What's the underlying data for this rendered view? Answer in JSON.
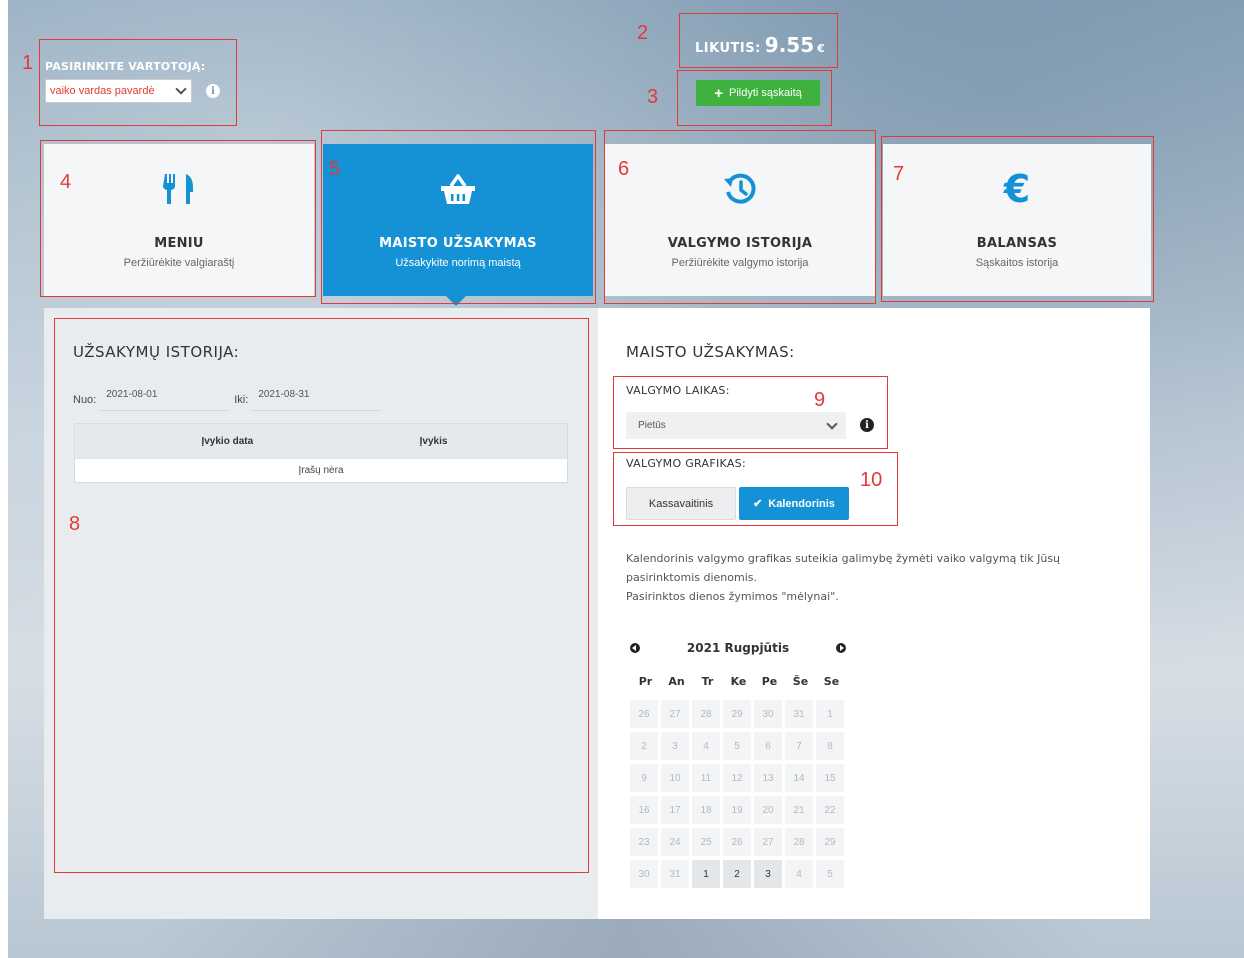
{
  "user_selector": {
    "label": "PASIRINKITE VARTOTOJĄ:",
    "selected": "vaiko vardas pavardė",
    "info_icon": "info-icon"
  },
  "balance": {
    "label": "LIKUTIS:",
    "amount": "9.55",
    "currency": "€"
  },
  "topup": {
    "label": "Pildyti sąskaitą",
    "icon": "plus-icon",
    "color": "#3fb13f"
  },
  "cards": [
    {
      "title": "MENIU",
      "subtitle": "Peržiūrėkite valgiaraštį",
      "icon": "fork-knife-icon",
      "active": false
    },
    {
      "title": "MAISTO UŽSAKYMAS",
      "subtitle": "Užsakykite norimą maistą",
      "icon": "basket-icon",
      "active": true
    },
    {
      "title": "VALGYMO ISTORIJA",
      "subtitle": "Peržiūrėkite valgymo istorija",
      "icon": "history-icon",
      "active": false
    },
    {
      "title": "BALANSAS",
      "subtitle": "Sąskaitos istorija",
      "icon": "euro-icon",
      "active": false
    }
  ],
  "order_history": {
    "title": "UŽSAKYMŲ ISTORIJA:",
    "from_label": "Nuo:",
    "from_value": "2021-08-01",
    "to_label": "Iki:",
    "to_value": "2021-08-31",
    "columns": [
      "Įvykio data",
      "Įvykis"
    ],
    "empty_text": "Įrašų nėra"
  },
  "food_order": {
    "title": "MAISTO UŽSAKYMAS:",
    "meal_time_label": "VALGYMO LAIKAS:",
    "meal_time_value": "Pietūs",
    "schedule_label": "VALGYMO GRAFIKAS:",
    "schedule_options": [
      "Kassavaitinis",
      "Kalendorinis"
    ],
    "schedule_selected": "Kalendorinis",
    "description_1": "Kalendorinis valgymo grafikas suteikia galimybę žymėti vaiko valgymą tik Jūsų pasirinktomis dienomis.",
    "description_2": "Pasirinktos dienos žymimos \"mėlynai\"."
  },
  "calendar": {
    "title": "2021 Rugpjūtis",
    "weekdays": [
      "Pr",
      "An",
      "Tr",
      "Ke",
      "Pe",
      "Še",
      "Se"
    ],
    "rows": [
      [
        "26",
        "27",
        "28",
        "29",
        "30",
        "31",
        "1"
      ],
      [
        "2",
        "3",
        "4",
        "5",
        "6",
        "7",
        "8"
      ],
      [
        "9",
        "10",
        "11",
        "12",
        "13",
        "14",
        "15"
      ],
      [
        "16",
        "17",
        "18",
        "19",
        "20",
        "21",
        "22"
      ],
      [
        "23",
        "24",
        "25",
        "26",
        "27",
        "28",
        "29"
      ],
      [
        "30",
        "31",
        "1",
        "2",
        "3",
        "4",
        "5"
      ]
    ],
    "highlighted": [
      [
        5,
        2
      ],
      [
        5,
        3
      ],
      [
        5,
        4
      ]
    ]
  },
  "annotations": [
    "1",
    "2",
    "3",
    "4",
    "5",
    "6",
    "7",
    "8",
    "9",
    "10"
  ],
  "colors": {
    "accent": "#1592d5",
    "annotation": "#e53935",
    "select_text": "#e53935"
  }
}
